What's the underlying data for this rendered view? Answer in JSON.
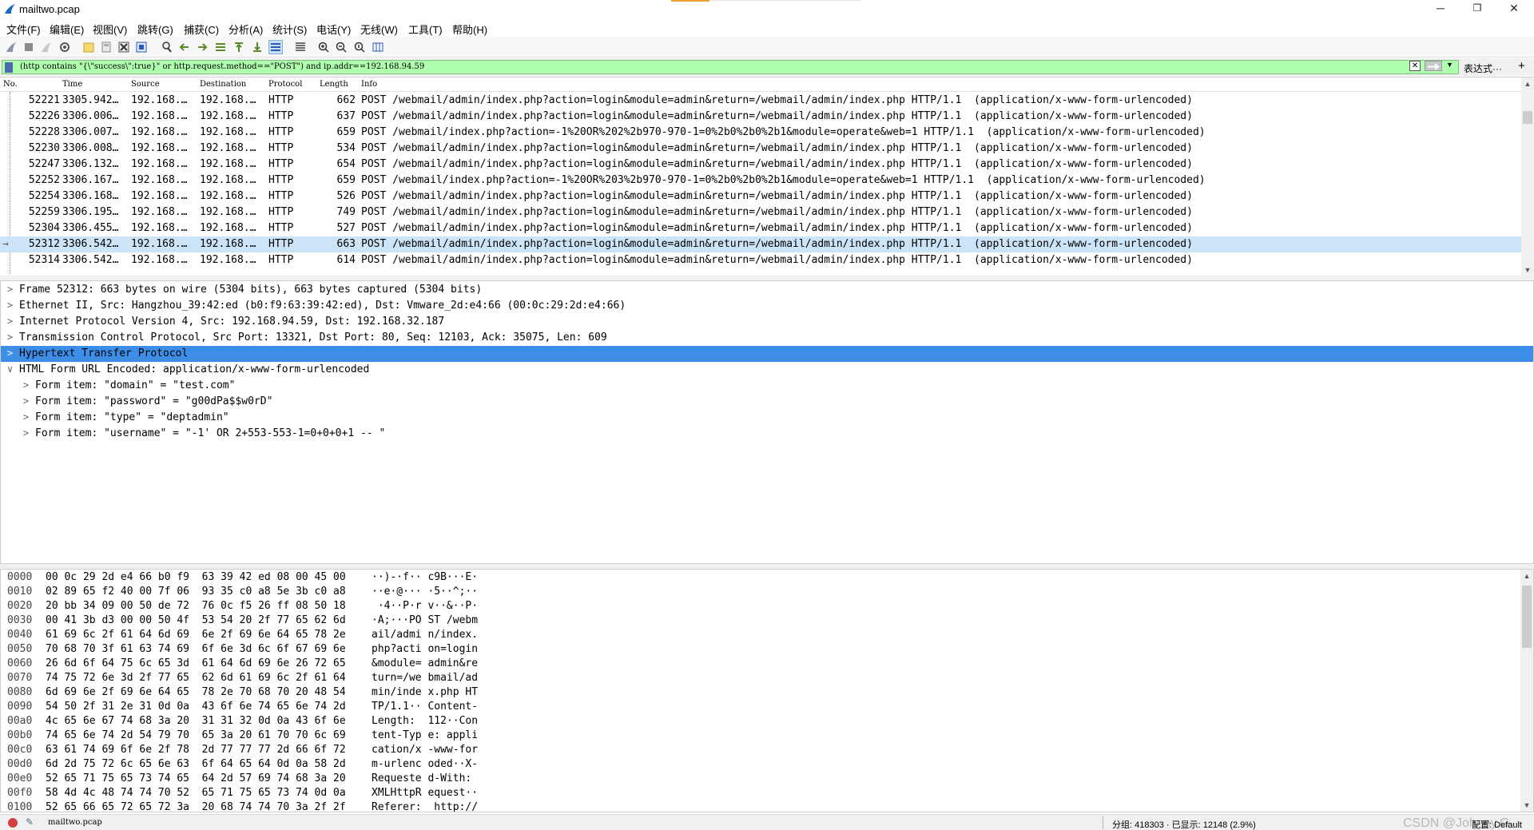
{
  "window": {
    "title": "mailtwo.pcap",
    "minimize": "─",
    "restore": "❐",
    "close": "✕"
  },
  "menu": [
    "文件(F)",
    "编辑(E)",
    "视图(V)",
    "跳转(G)",
    "捕获(C)",
    "分析(A)",
    "统计(S)",
    "电话(Y)",
    "无线(W)",
    "工具(T)",
    "帮助(H)"
  ],
  "toolbar_icons": [
    "shark-fin-start-icon",
    "stop-icon",
    "restart-icon",
    "options-gear-icon",
    "open-folder-icon",
    "save-file-icon",
    "close-file-icon",
    "reload-icon",
    "find-icon",
    "back-arrow-icon",
    "forward-arrow-icon",
    "goto-packet-icon",
    "first-packet-icon",
    "last-packet-icon",
    "autoscroll-icon",
    "colorize-icon",
    "zoom-in-icon",
    "zoom-out-icon",
    "zoom-normal-icon",
    "resize-columns-icon"
  ],
  "filter": {
    "expression": "(http contains \"{\\\"success\\\":true}\" or http.request.method==\"POST\") and ip.addr==192.168.94.59",
    "clear": "✕",
    "dropdown": "▼",
    "expression_label": "表达式···",
    "add": "+"
  },
  "packet_list": {
    "columns": [
      "No.",
      "Time",
      "Source",
      "Destination",
      "Protocol",
      "Length",
      "Info"
    ],
    "rows": [
      {
        "no": "52221",
        "time": "3305.942…",
        "src": "192.168.…",
        "dst": "192.168.…",
        "proto": "HTTP",
        "len": "662",
        "info": "POST /webmail/admin/index.php?action=login&module=admin&return=/webmail/admin/index.php HTTP/1.1  (application/x-www-form-urlencoded)"
      },
      {
        "no": "52226",
        "time": "3306.006…",
        "src": "192.168.…",
        "dst": "192.168.…",
        "proto": "HTTP",
        "len": "637",
        "info": "POST /webmail/admin/index.php?action=login&module=admin&return=/webmail/admin/index.php HTTP/1.1  (application/x-www-form-urlencoded)"
      },
      {
        "no": "52228",
        "time": "3306.007…",
        "src": "192.168.…",
        "dst": "192.168.…",
        "proto": "HTTP",
        "len": "659",
        "info": "POST /webmail/index.php?action=-1%20OR%202%2b970-970-1=0%2b0%2b0%2b1&module=operate&web=1 HTTP/1.1  (application/x-www-form-urlencoded)"
      },
      {
        "no": "52230",
        "time": "3306.008…",
        "src": "192.168.…",
        "dst": "192.168.…",
        "proto": "HTTP",
        "len": "534",
        "info": "POST /webmail/admin/index.php?action=login&module=admin&return=/webmail/admin/index.php HTTP/1.1  (application/x-www-form-urlencoded)"
      },
      {
        "no": "52247",
        "time": "3306.132…",
        "src": "192.168.…",
        "dst": "192.168.…",
        "proto": "HTTP",
        "len": "654",
        "info": "POST /webmail/admin/index.php?action=login&module=admin&return=/webmail/admin/index.php HTTP/1.1  (application/x-www-form-urlencoded)"
      },
      {
        "no": "52252",
        "time": "3306.167…",
        "src": "192.168.…",
        "dst": "192.168.…",
        "proto": "HTTP",
        "len": "659",
        "info": "POST /webmail/index.php?action=-1%20OR%203%2b970-970-1=0%2b0%2b0%2b1&module=operate&web=1 HTTP/1.1  (application/x-www-form-urlencoded)"
      },
      {
        "no": "52254",
        "time": "3306.168…",
        "src": "192.168.…",
        "dst": "192.168.…",
        "proto": "HTTP",
        "len": "526",
        "info": "POST /webmail/admin/index.php?action=login&module=admin&return=/webmail/admin/index.php HTTP/1.1  (application/x-www-form-urlencoded)"
      },
      {
        "no": "52259",
        "time": "3306.195…",
        "src": "192.168.…",
        "dst": "192.168.…",
        "proto": "HTTP",
        "len": "749",
        "info": "POST /webmail/admin/index.php?action=login&module=admin&return=/webmail/admin/index.php HTTP/1.1  (application/x-www-form-urlencoded)"
      },
      {
        "no": "52304",
        "time": "3306.455…",
        "src": "192.168.…",
        "dst": "192.168.…",
        "proto": "HTTP",
        "len": "527",
        "info": "POST /webmail/admin/index.php?action=login&module=admin&return=/webmail/admin/index.php HTTP/1.1  (application/x-www-form-urlencoded)"
      },
      {
        "no": "52312",
        "time": "3306.542…",
        "src": "192.168.…",
        "dst": "192.168.…",
        "proto": "HTTP",
        "len": "663",
        "info": "POST /webmail/admin/index.php?action=login&module=admin&return=/webmail/admin/index.php HTTP/1.1  (application/x-www-form-urlencoded)",
        "selected": true
      },
      {
        "no": "52314",
        "time": "3306.542…",
        "src": "192.168.…",
        "dst": "192.168.…",
        "proto": "HTTP",
        "len": "614",
        "info": "POST /webmail/admin/index.php?action=login&module=admin&return=/webmail/admin/index.php HTTP/1.1  (application/x-www-form-urlencoded)"
      }
    ],
    "related_marker": "→"
  },
  "details": [
    {
      "arrow": ">",
      "text": "Frame 52312: 663 bytes on wire (5304 bits), 663 bytes captured (5304 bits)",
      "level": 0
    },
    {
      "arrow": ">",
      "text": "Ethernet II, Src: Hangzhou_39:42:ed (b0:f9:63:39:42:ed), Dst: Vmware_2d:e4:66 (00:0c:29:2d:e4:66)",
      "level": 0
    },
    {
      "arrow": ">",
      "text": "Internet Protocol Version 4, Src: 192.168.94.59, Dst: 192.168.32.187",
      "level": 0
    },
    {
      "arrow": ">",
      "text": "Transmission Control Protocol, Src Port: 13321, Dst Port: 80, Seq: 12103, Ack: 35075, Len: 609",
      "level": 0
    },
    {
      "arrow": ">",
      "text": "Hypertext Transfer Protocol",
      "level": 0,
      "selected": true
    },
    {
      "arrow": "∨",
      "text": "HTML Form URL Encoded: application/x-www-form-urlencoded",
      "level": 0
    },
    {
      "arrow": ">",
      "text": "Form item: \"domain\" = \"test.com\"",
      "level": 1
    },
    {
      "arrow": ">",
      "text": "Form item: \"password\" = \"g00dPa$$w0rD\"",
      "level": 1
    },
    {
      "arrow": ">",
      "text": "Form item: \"type\" = \"deptadmin\"",
      "level": 1
    },
    {
      "arrow": ">",
      "text": "Form item: \"username\" = \"-1' OR 2+553-553-1=0+0+0+1 -- \"",
      "level": 1
    }
  ],
  "bytes": [
    {
      "off": "0000",
      "hex": "00 0c 29 2d e4 66 b0 f9  63 39 42 ed 08 00 45 00",
      "ascii": "··)-·f·· c9B···E·"
    },
    {
      "off": "0010",
      "hex": "02 89 65 f2 40 00 7f 06  93 35 c0 a8 5e 3b c0 a8",
      "ascii": "··e·@··· ·5··^;··"
    },
    {
      "off": "0020",
      "hex": "20 bb 34 09 00 50 de 72  76 0c f5 26 ff 08 50 18",
      "ascii": " ·4··P·r v··&··P·"
    },
    {
      "off": "0030",
      "hex": "00 41 3b d3 00 00 50 4f  53 54 20 2f 77 65 62 6d",
      "ascii": "·A;···PO ST /webm"
    },
    {
      "off": "0040",
      "hex": "61 69 6c 2f 61 64 6d 69  6e 2f 69 6e 64 65 78 2e",
      "ascii": "ail/admi n/index."
    },
    {
      "off": "0050",
      "hex": "70 68 70 3f 61 63 74 69  6f 6e 3d 6c 6f 67 69 6e",
      "ascii": "php?acti on=login"
    },
    {
      "off": "0060",
      "hex": "26 6d 6f 64 75 6c 65 3d  61 64 6d 69 6e 26 72 65",
      "ascii": "&module= admin&re"
    },
    {
      "off": "0070",
      "hex": "74 75 72 6e 3d 2f 77 65  62 6d 61 69 6c 2f 61 64",
      "ascii": "turn=/we bmail/ad"
    },
    {
      "off": "0080",
      "hex": "6d 69 6e 2f 69 6e 64 65  78 2e 70 68 70 20 48 54",
      "ascii": "min/inde x.php HT"
    },
    {
      "off": "0090",
      "hex": "54 50 2f 31 2e 31 0d 0a  43 6f 6e 74 65 6e 74 2d",
      "ascii": "TP/1.1·· Content-"
    },
    {
      "off": "00a0",
      "hex": "4c 65 6e 67 74 68 3a 20  31 31 32 0d 0a 43 6f 6e",
      "ascii": "Length:  112··Con"
    },
    {
      "off": "00b0",
      "hex": "74 65 6e 74 2d 54 79 70  65 3a 20 61 70 70 6c 69",
      "ascii": "tent-Typ e: appli"
    },
    {
      "off": "00c0",
      "hex": "63 61 74 69 6f 6e 2f 78  2d 77 77 77 2d 66 6f 72",
      "ascii": "cation/x -www-for"
    },
    {
      "off": "00d0",
      "hex": "6d 2d 75 72 6c 65 6e 63  6f 64 65 64 0d 0a 58 2d",
      "ascii": "m-urlenc oded··X-"
    },
    {
      "off": "00e0",
      "hex": "52 65 71 75 65 73 74 65  64 2d 57 69 74 68 3a 20",
      "ascii": "Requeste d-With: "
    },
    {
      "off": "00f0",
      "hex": "58 4d 4c 48 74 74 70 52  65 71 75 65 73 74 0d 0a",
      "ascii": "XMLHttpR equest··"
    },
    {
      "off": "0100",
      "hex": "52 65 66 65 72 65 72 3a  20 68 74 74 70 3a 2f 2f",
      "ascii": "Referer:  http://"
    }
  ],
  "status": {
    "file": "mailtwo.pcap",
    "edit_icon": "✎",
    "packets": "分组: 418303 · 已显示: 12148 (2.9%)",
    "watermark": "CSDN @Johnny.G",
    "profile": "配置: Default"
  },
  "colors": {
    "filter_valid": "#afffaf",
    "row_selected": "#cce4f7",
    "tree_selected": "#3d8ee8"
  }
}
